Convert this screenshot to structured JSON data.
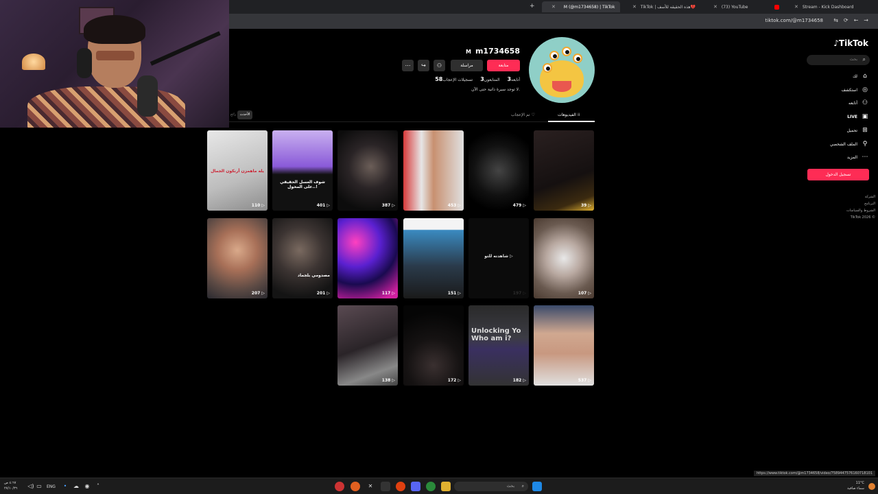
{
  "browser": {
    "tabs": [
      {
        "label": "M (@m1734658) | TikTok",
        "active": true
      },
      {
        "label": "TikTok | هذه الحقيقه للأسف💔",
        "active": false
      },
      {
        "label": "(73) YouTube",
        "active": false
      },
      {
        "label": "Stream - Kick Dashboard",
        "active": false
      }
    ],
    "url": "tiktok.com/@m1734658",
    "status_url": "https://www.tiktok.com/@m1734658/video/7589447576160718101"
  },
  "sidebar": {
    "logo": "TikTok",
    "search_placeholder": "بحث",
    "items": [
      {
        "label": "لك",
        "icon": "home-icon"
      },
      {
        "label": "استكشف",
        "icon": "compass-icon"
      },
      {
        "label": "أتابعه",
        "icon": "following-icon"
      },
      {
        "label": "LIVE",
        "icon": "live-icon"
      },
      {
        "label": "تحميل",
        "icon": "upload-icon"
      },
      {
        "label": "الملف الشخصي",
        "icon": "profile-icon"
      },
      {
        "label": "المزيد",
        "icon": "more-icon"
      }
    ],
    "signin_label": "تسجيل الدخول",
    "footer": [
      "الشركة",
      "البرنامج",
      "الشروط والسياسات",
      "TikTok 2026 ©"
    ]
  },
  "profile": {
    "username": "m1734658",
    "nickname": "M",
    "follow_label": "متابعة",
    "message_label": "مراسلة",
    "stats": {
      "following_label": "أتابعه",
      "following_value": "3",
      "followers_label": "المتابعون",
      "followers_value": "3",
      "likes_label": "تسجيلات الإعجاب",
      "likes_value": "58"
    },
    "bio": "لا توجد سيرة ذاتية حتى الآن."
  },
  "content_tabs": {
    "videos": "الفيديوهات",
    "liked": "تم الإعجاب",
    "latest": "الأحدث",
    "popular": "رائج"
  },
  "videos": [
    {
      "views": "110",
      "caption": "يله ماهمزن أرنكون الجمال"
    },
    {
      "views": "401",
      "caption": "شوف الغسل الحقيقي على المحول..!"
    },
    {
      "views": "387",
      "caption": ""
    },
    {
      "views": "453",
      "caption": ""
    },
    {
      "views": "479",
      "caption": ""
    },
    {
      "views": "39",
      "caption": ""
    },
    {
      "views": "207",
      "caption": ""
    },
    {
      "views": "201",
      "caption": "مصدومي بلجماد"
    },
    {
      "views": "117",
      "caption": ""
    },
    {
      "views": "151",
      "caption": ""
    },
    {
      "views": "197",
      "caption": "شاهدته للتو"
    },
    {
      "views": "107",
      "caption": ""
    },
    {
      "views": "138",
      "caption": ""
    },
    {
      "views": "172",
      "caption": ""
    },
    {
      "views": "182",
      "caption": "Unlocking Yo Who am i?"
    },
    {
      "views": "537",
      "caption": ""
    }
  ],
  "taskbar": {
    "lang": "ENG",
    "search_placeholder": "بحث",
    "time": "٤:٦٧ ص",
    "date": "٢٧/١٠/٣٦",
    "weather": "11°C",
    "weather_desc": "سماء صافية"
  },
  "colors": {
    "accent": "#fe2c55",
    "bg": "#000000",
    "panel": "#2f2f2f"
  }
}
